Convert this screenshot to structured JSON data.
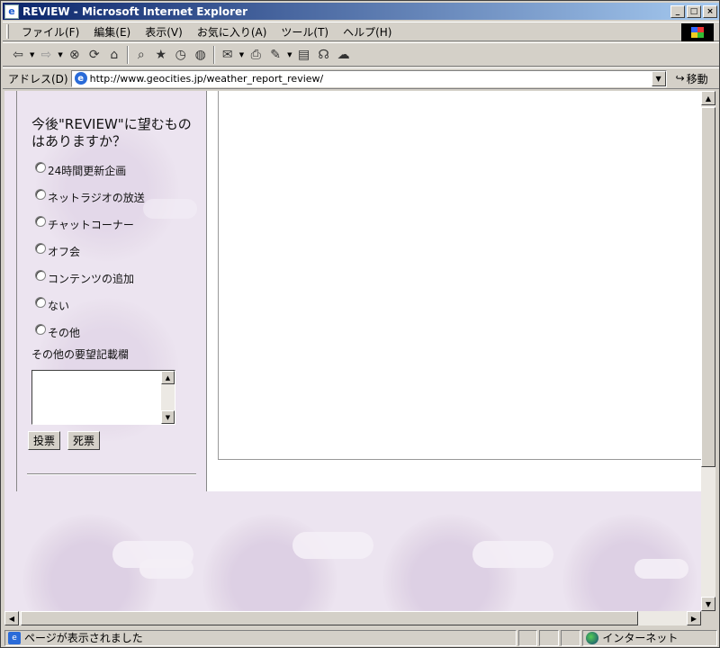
{
  "window": {
    "title": "REVIEW - Microsoft Internet Explorer",
    "minimize": "_",
    "maximize": "□",
    "close": "×"
  },
  "menubar": {
    "items": [
      "ファイル(F)",
      "編集(E)",
      "表示(V)",
      "お気に入り(A)",
      "ツール(T)",
      "ヘルプ(H)"
    ]
  },
  "toolbar": {
    "icons": [
      "back-icon",
      "forward-icon",
      "stop-icon",
      "refresh-icon",
      "home-icon",
      "search-icon",
      "favorites-icon",
      "history-icon",
      "channels-icon",
      "mail-icon",
      "print-icon",
      "edit-icon",
      "discuss-icon",
      "messenger-icon"
    ]
  },
  "address": {
    "label": "アドレス(D)",
    "url": "http://www.geocities.jp/weather_report_review/",
    "go_label": "移動"
  },
  "survey": {
    "question": "今後\"REVIEW\"に望むものはありますか？",
    "options": [
      "24時間更新企画",
      "ネットラジオの放送",
      "チャットコーナー",
      "オフ会",
      "コンテンツの追加",
      "ない",
      "その他"
    ],
    "other_label": "その他の要望記載欄",
    "textarea_value": "",
    "vote_button": "投票",
    "dead_vote_button": "死票"
  },
  "status": {
    "text": "ページが表示されました",
    "zone": "インターネット"
  }
}
